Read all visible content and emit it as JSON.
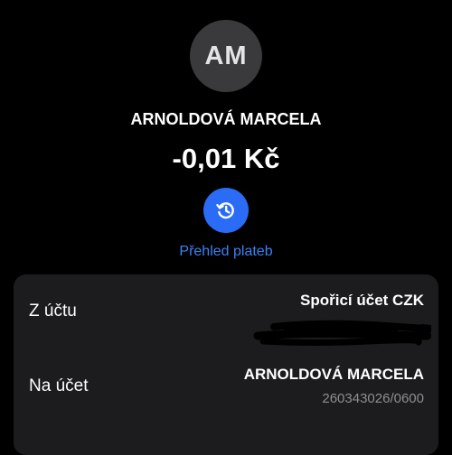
{
  "header": {
    "avatar_initials": "AM",
    "name": "ARNOLDOVÁ MARCELA",
    "amount": "-0,01 Kč",
    "history_icon": "history-icon",
    "history_label": "Přehled plateb"
  },
  "details": {
    "from_account": {
      "label": "Z účtu",
      "value": "Spořicí účet CZK"
    },
    "to_account": {
      "label": "Na účet",
      "value": "ARNOLDOVÁ MARCELA",
      "account_number": "260343026/0600"
    }
  },
  "colors": {
    "background": "#000000",
    "card": "#1c1c1e",
    "accent": "#2b6cf6",
    "accent_text": "#3b82f6",
    "secondary_text": "#8e8e93",
    "avatar_bg": "#3a3a3c"
  }
}
